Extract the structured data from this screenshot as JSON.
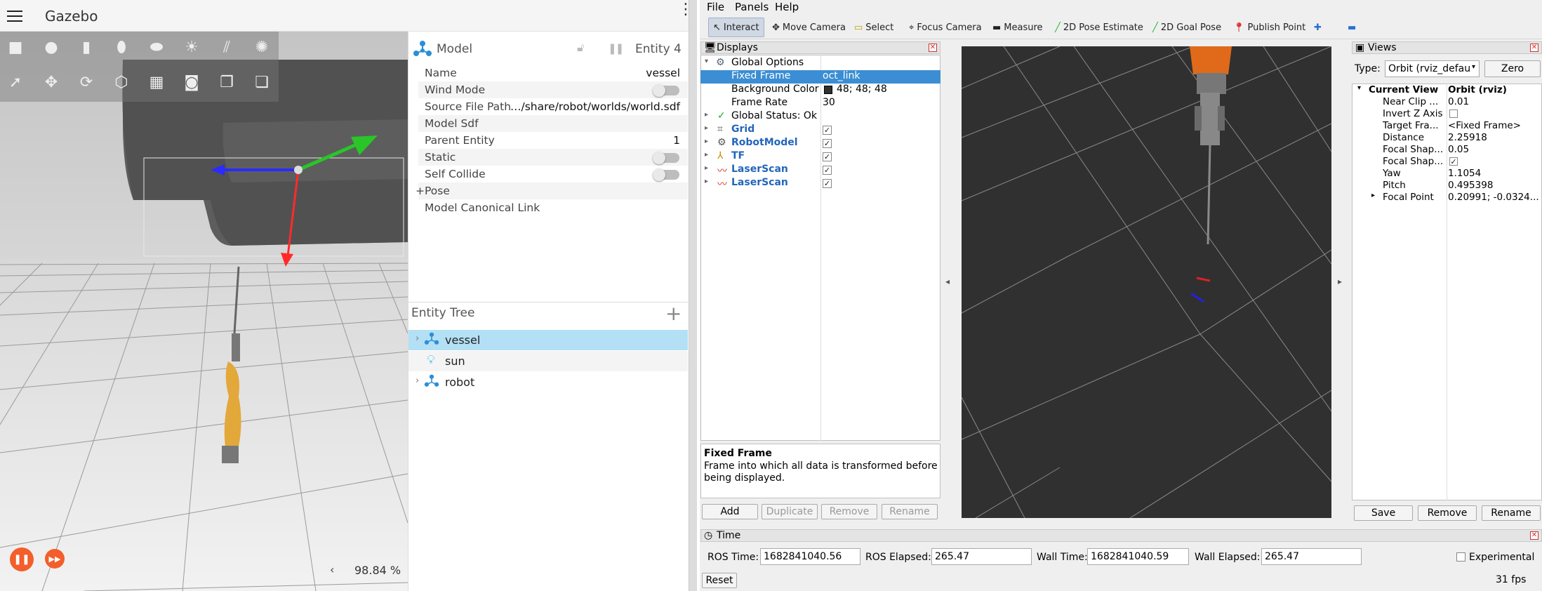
{
  "gazebo": {
    "title": "Gazebo",
    "rtf_value": "98.84 %",
    "model_panel": {
      "title": "Model",
      "entity_label": "Entity 4",
      "properties": {
        "name_key": "Name",
        "name_value": "vessel",
        "wind_key": "Wind Mode",
        "source_key": "Source File Path",
        "source_value": "…/share/robot/worlds/world.sdf",
        "sdf_key": "Model Sdf",
        "parent_key": "Parent Entity",
        "parent_value": "1",
        "static_key": "Static",
        "collide_key": "Self Collide",
        "pose_key": "Pose",
        "canonical_key": "Model Canonical Link"
      }
    },
    "entity_tree": {
      "title": "Entity Tree",
      "items": [
        "vessel",
        "sun",
        "robot"
      ]
    }
  },
  "rviz": {
    "menu": [
      "File",
      "Panels",
      "Help"
    ],
    "tools": [
      "Interact",
      "Move Camera",
      "Select",
      "Focus Camera",
      "Measure",
      "2D Pose Estimate",
      "2D Goal Pose",
      "Publish Point"
    ],
    "displays": {
      "title": "Displays",
      "global_options": "Global Options",
      "fixed_frame_key": "Fixed Frame",
      "fixed_frame_value": "oct_link",
      "bg_key": "Background Color",
      "bg_value": "48; 48; 48",
      "rate_key": "Frame Rate",
      "rate_value": "30",
      "status": "Global Status: Ok",
      "items": [
        "Grid",
        "RobotModel",
        "TF",
        "LaserScan",
        "LaserScan"
      ],
      "help_title": "Fixed Frame",
      "help_text": "Frame into which all data is transformed before being displayed.",
      "buttons": [
        "Add",
        "Duplicate",
        "Remove",
        "Rename"
      ]
    },
    "views": {
      "title": "Views",
      "type_label": "Type:",
      "type_value": "Orbit (rviz_defau",
      "zero": "Zero",
      "current_view_key": "Current View",
      "current_view_value": "Orbit (rviz)",
      "near_clip_key": "Near Clip ...",
      "near_clip_value": "0.01",
      "invert_key": "Invert Z Axis",
      "target_key": "Target Fra...",
      "target_value": "<Fixed Frame>",
      "distance_key": "Distance",
      "distance_value": "2.25918",
      "focal_size_key": "Focal Shap...",
      "focal_size_value": "0.05",
      "focal_fixed_key": "Focal Shap...",
      "yaw_key": "Yaw",
      "yaw_value": "1.1054",
      "pitch_key": "Pitch",
      "pitch_value": "0.495398",
      "focal_point_key": "Focal Point",
      "focal_point_value": "0.20991; -0.0324...",
      "buttons": [
        "Save",
        "Remove",
        "Rename"
      ]
    },
    "time": {
      "title": "Time",
      "ros_time_label": "ROS Time:",
      "ros_time": "1682841040.56",
      "ros_elapsed_label": "ROS Elapsed:",
      "ros_elapsed": "265.47",
      "wall_time_label": "Wall Time:",
      "wall_time": "1682841040.59",
      "wall_elapsed_label": "Wall Elapsed:",
      "wall_elapsed": "265.47",
      "experimental": "Experimental",
      "reset": "Reset",
      "fps": "31 fps"
    }
  }
}
